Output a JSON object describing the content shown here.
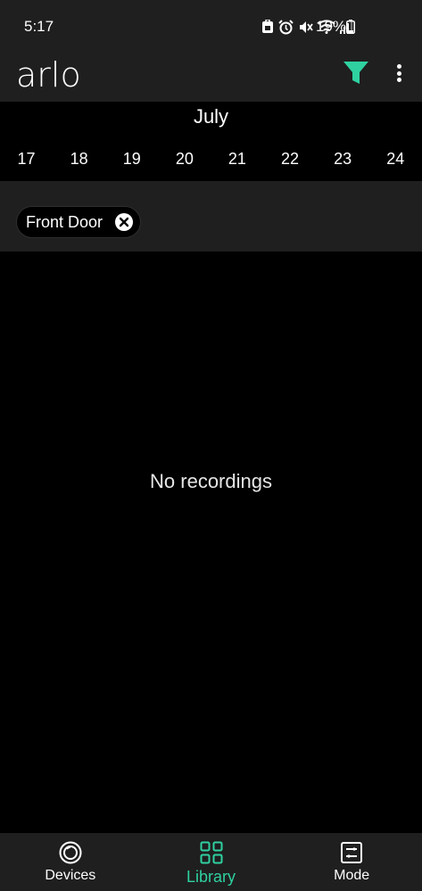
{
  "status_bar": {
    "time": "5:17",
    "battery_percent": "19%",
    "icons": [
      "lock-notification-icon",
      "alarm-icon",
      "mute-icon",
      "wifi-icon",
      "signal-icon",
      "battery-icon"
    ]
  },
  "header": {
    "logo_text": "arlo",
    "filter_icon": "filter-icon",
    "more_icon": "more-vertical-icon",
    "accent_color": "#2fd1a0"
  },
  "calendar": {
    "month": "July",
    "days": [
      "17",
      "18",
      "19",
      "20",
      "21",
      "22",
      "23",
      "24"
    ]
  },
  "filters": {
    "chips": [
      {
        "label": "Front Door",
        "icon": "close-circle-icon"
      }
    ]
  },
  "content": {
    "empty_message": "No recordings"
  },
  "bottom_nav": {
    "items": [
      {
        "label": "Devices",
        "icon": "devices-icon",
        "active": false
      },
      {
        "label": "Library",
        "icon": "library-grid-icon",
        "active": true
      },
      {
        "label": "Mode",
        "icon": "mode-icon",
        "active": false
      }
    ]
  }
}
